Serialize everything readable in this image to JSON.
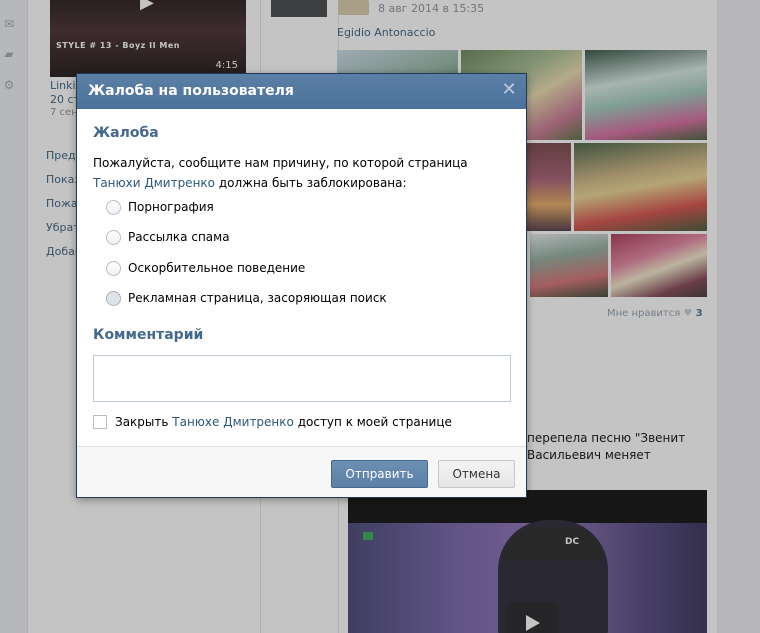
{
  "background": {
    "video": {
      "overlay_text": "STYLE # 13 - Boyz II Men",
      "duration": "4:15"
    },
    "video_meta": {
      "title": "Linki",
      "views": "20 ст",
      "date": "7 сен"
    },
    "left_links": [
      "Пред",
      "Показ",
      "Пожа",
      "Убрат",
      "Добав"
    ],
    "post": {
      "date": "8 авг 2014 в 15:35",
      "author": "Egidio Antonaccio",
      "likes_label": "Мне нравится",
      "likes_count": "3",
      "song_line1": "перепела песню \"Звенит",
      "song_line2": "Васильевич меняет"
    },
    "big_video_cap_text": "DC"
  },
  "dialog": {
    "title": "Жалоба на пользователя",
    "close_icon": "close-icon",
    "complaint_heading": "Жалоба",
    "intro": {
      "before": "Пожалуйста, сообщите нам причину, по которой страница",
      "user_link": "Танюхи Дмитренко",
      "after": "должна быть заблокирована:"
    },
    "reasons": [
      {
        "label": "Порнография"
      },
      {
        "label": "Рассылка спама"
      },
      {
        "label": "Оскорбительное поведение"
      },
      {
        "label": "Рекламная страница, засоряющая поиск"
      }
    ],
    "comment_heading": "Комментарий",
    "comment_value": "",
    "block_access": {
      "before": "Закрыть",
      "user_link": "Танюхе Дмитренко",
      "after": "доступ к моей странице",
      "checked": false
    },
    "send_label": "Отправить",
    "cancel_label": "Отмена"
  },
  "colors": {
    "accent": "#5b7fa6",
    "link": "#2b587a",
    "heading": "#45688e"
  }
}
